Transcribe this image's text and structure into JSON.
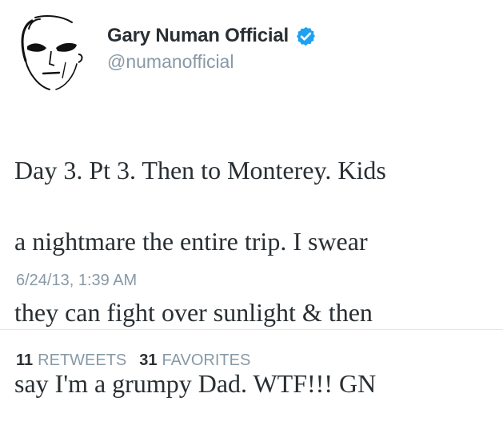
{
  "user": {
    "display_name": "Gary Numan Official",
    "handle": "@numanofficial",
    "verified_icon": "verified-badge-icon",
    "avatar_icon": "face-sketch-avatar"
  },
  "tweet": {
    "text_lines": [
      "Day 3. Pt 3. Then to Monterey. Kids",
      "a nightmare the entire trip. I swear",
      "they can fight over sunlight & then",
      "say I'm a grumpy Dad. WTF!!! GN"
    ],
    "timestamp": "6/24/13, 1:39 AM"
  },
  "stats": {
    "retweets_count": "11",
    "retweets_label": "RETWEETS",
    "favorites_count": "31",
    "favorites_label": "FAVORITES"
  },
  "colors": {
    "text": "#292f33",
    "muted": "#8899a6",
    "verified": "#1da1f2",
    "divider": "#e1e8ed"
  }
}
